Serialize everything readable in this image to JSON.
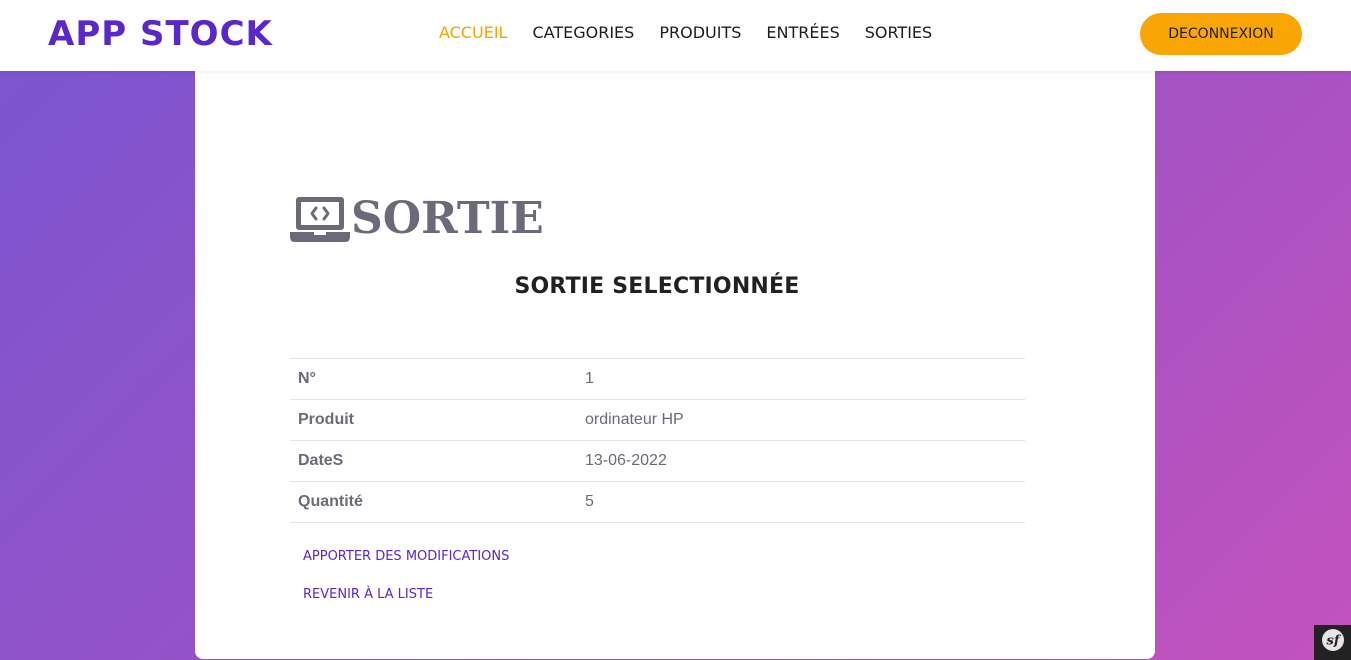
{
  "brand": "APP STOCK",
  "nav": {
    "items": [
      {
        "label": "ACCUEIL",
        "active": true
      },
      {
        "label": "CATEGORIES"
      },
      {
        "label": "PRODUITS"
      },
      {
        "label": "ENTRÉES"
      },
      {
        "label": "SORTIES"
      }
    ],
    "active_color": "#f0a500"
  },
  "logout_label": "DECONNEXION",
  "page": {
    "heading": "SORTIE",
    "heading_icon": "laptop-code-icon",
    "subtitle": "SORTIE SELECTIONNÉE",
    "details": [
      {
        "label": "N°",
        "value": "1"
      },
      {
        "label": "Produit",
        "value": "ordinateur HP"
      },
      {
        "label": "DateS",
        "value": "13-06-2022"
      },
      {
        "label": "Quantité",
        "value": "5"
      }
    ],
    "actions": {
      "edit": "APPORTER DES MODIFICATIONS",
      "back": "REVENIR À LA LISTE"
    }
  },
  "colors": {
    "brand": "#5a27c8",
    "accent": "#f9a503",
    "text": "#6c6a78"
  },
  "debug_toolbar_icon": "symfony-icon"
}
